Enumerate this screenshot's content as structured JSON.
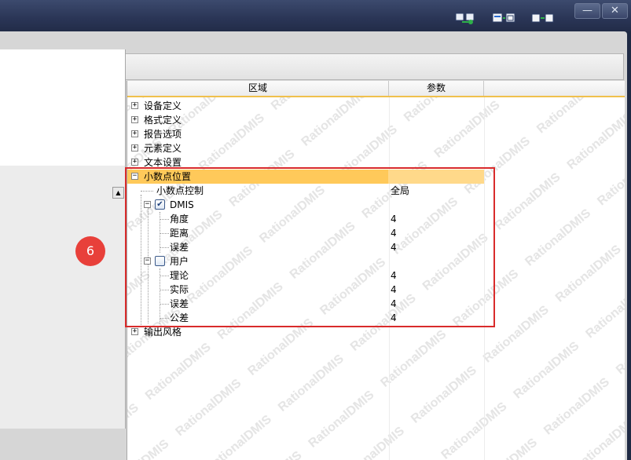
{
  "titlebar": {
    "icons": [
      "machine-link-icon",
      "window-layout-icon",
      "machine-sync-icon"
    ],
    "minimize_glyph": "—",
    "close_glyph": "✕"
  },
  "grid": {
    "columns": [
      "区域",
      "参数"
    ],
    "rows": [
      {
        "label": "设备定义",
        "expander": "+"
      },
      {
        "label": "格式定义",
        "expander": "+"
      },
      {
        "label": "报告选项",
        "expander": "+"
      },
      {
        "label": "元素定义",
        "expander": "+"
      },
      {
        "label": "文本设置",
        "expander": "+"
      },
      {
        "label": "小数点位置",
        "expander": "−",
        "selected": true
      },
      {
        "label": "小数点控制",
        "value": "全局"
      },
      {
        "label": "DMIS",
        "expander": "−",
        "checked": true
      },
      {
        "label": "角度",
        "value": "4"
      },
      {
        "label": "距离",
        "value": "4"
      },
      {
        "label": "误差",
        "value": "4"
      },
      {
        "label": "用户",
        "expander": "−",
        "checked": false
      },
      {
        "label": "理论",
        "value": "4"
      },
      {
        "label": "实际",
        "value": "4"
      },
      {
        "label": "误差",
        "value": "4"
      },
      {
        "label": "公差",
        "value": "4"
      },
      {
        "label": "输出风格",
        "expander": "+"
      }
    ],
    "watermark_text": "RationalDMIS"
  },
  "left_panel": {
    "scroll_up_glyph": "▲",
    "step_badge": "6"
  },
  "colors": {
    "selection": "#ffc95a",
    "highlight_border": "#d92b2b",
    "badge": "#e8403a"
  }
}
